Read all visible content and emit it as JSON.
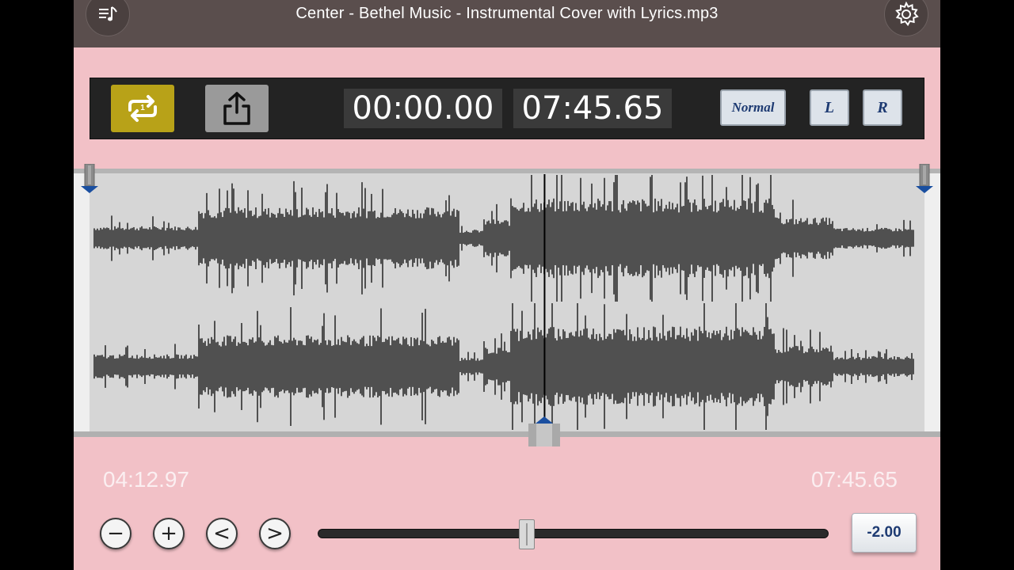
{
  "header": {
    "title": "Center - Bethel Music - Instrumental Cover with Lyrics.mp3",
    "library_icon": "music-list-icon",
    "settings_icon": "gear-icon"
  },
  "toolbar": {
    "loop_icon": "repeat-one-icon",
    "share_icon": "share-upload-icon",
    "start_time": "00:00.00",
    "end_time": "07:45.65",
    "normal_label": "Normal",
    "left_label": "L",
    "right_label": "R"
  },
  "waveform": {
    "playhead_fraction": 0.545
  },
  "position_label": "04:12.97",
  "duration_label": "07:45.65",
  "controls": {
    "minus_label": "−",
    "plus_label": "+",
    "prev_label": "<",
    "next_label": ">"
  },
  "speed": {
    "value_label": "-2.00",
    "fraction": 0.41
  },
  "colors": {
    "background": "#f2c1c7",
    "titlebar": "#5a4e4d",
    "toolbar": "#232323",
    "loop_active": "#b8a218",
    "waveform": "#505050",
    "marker": "#1a4fa0"
  }
}
